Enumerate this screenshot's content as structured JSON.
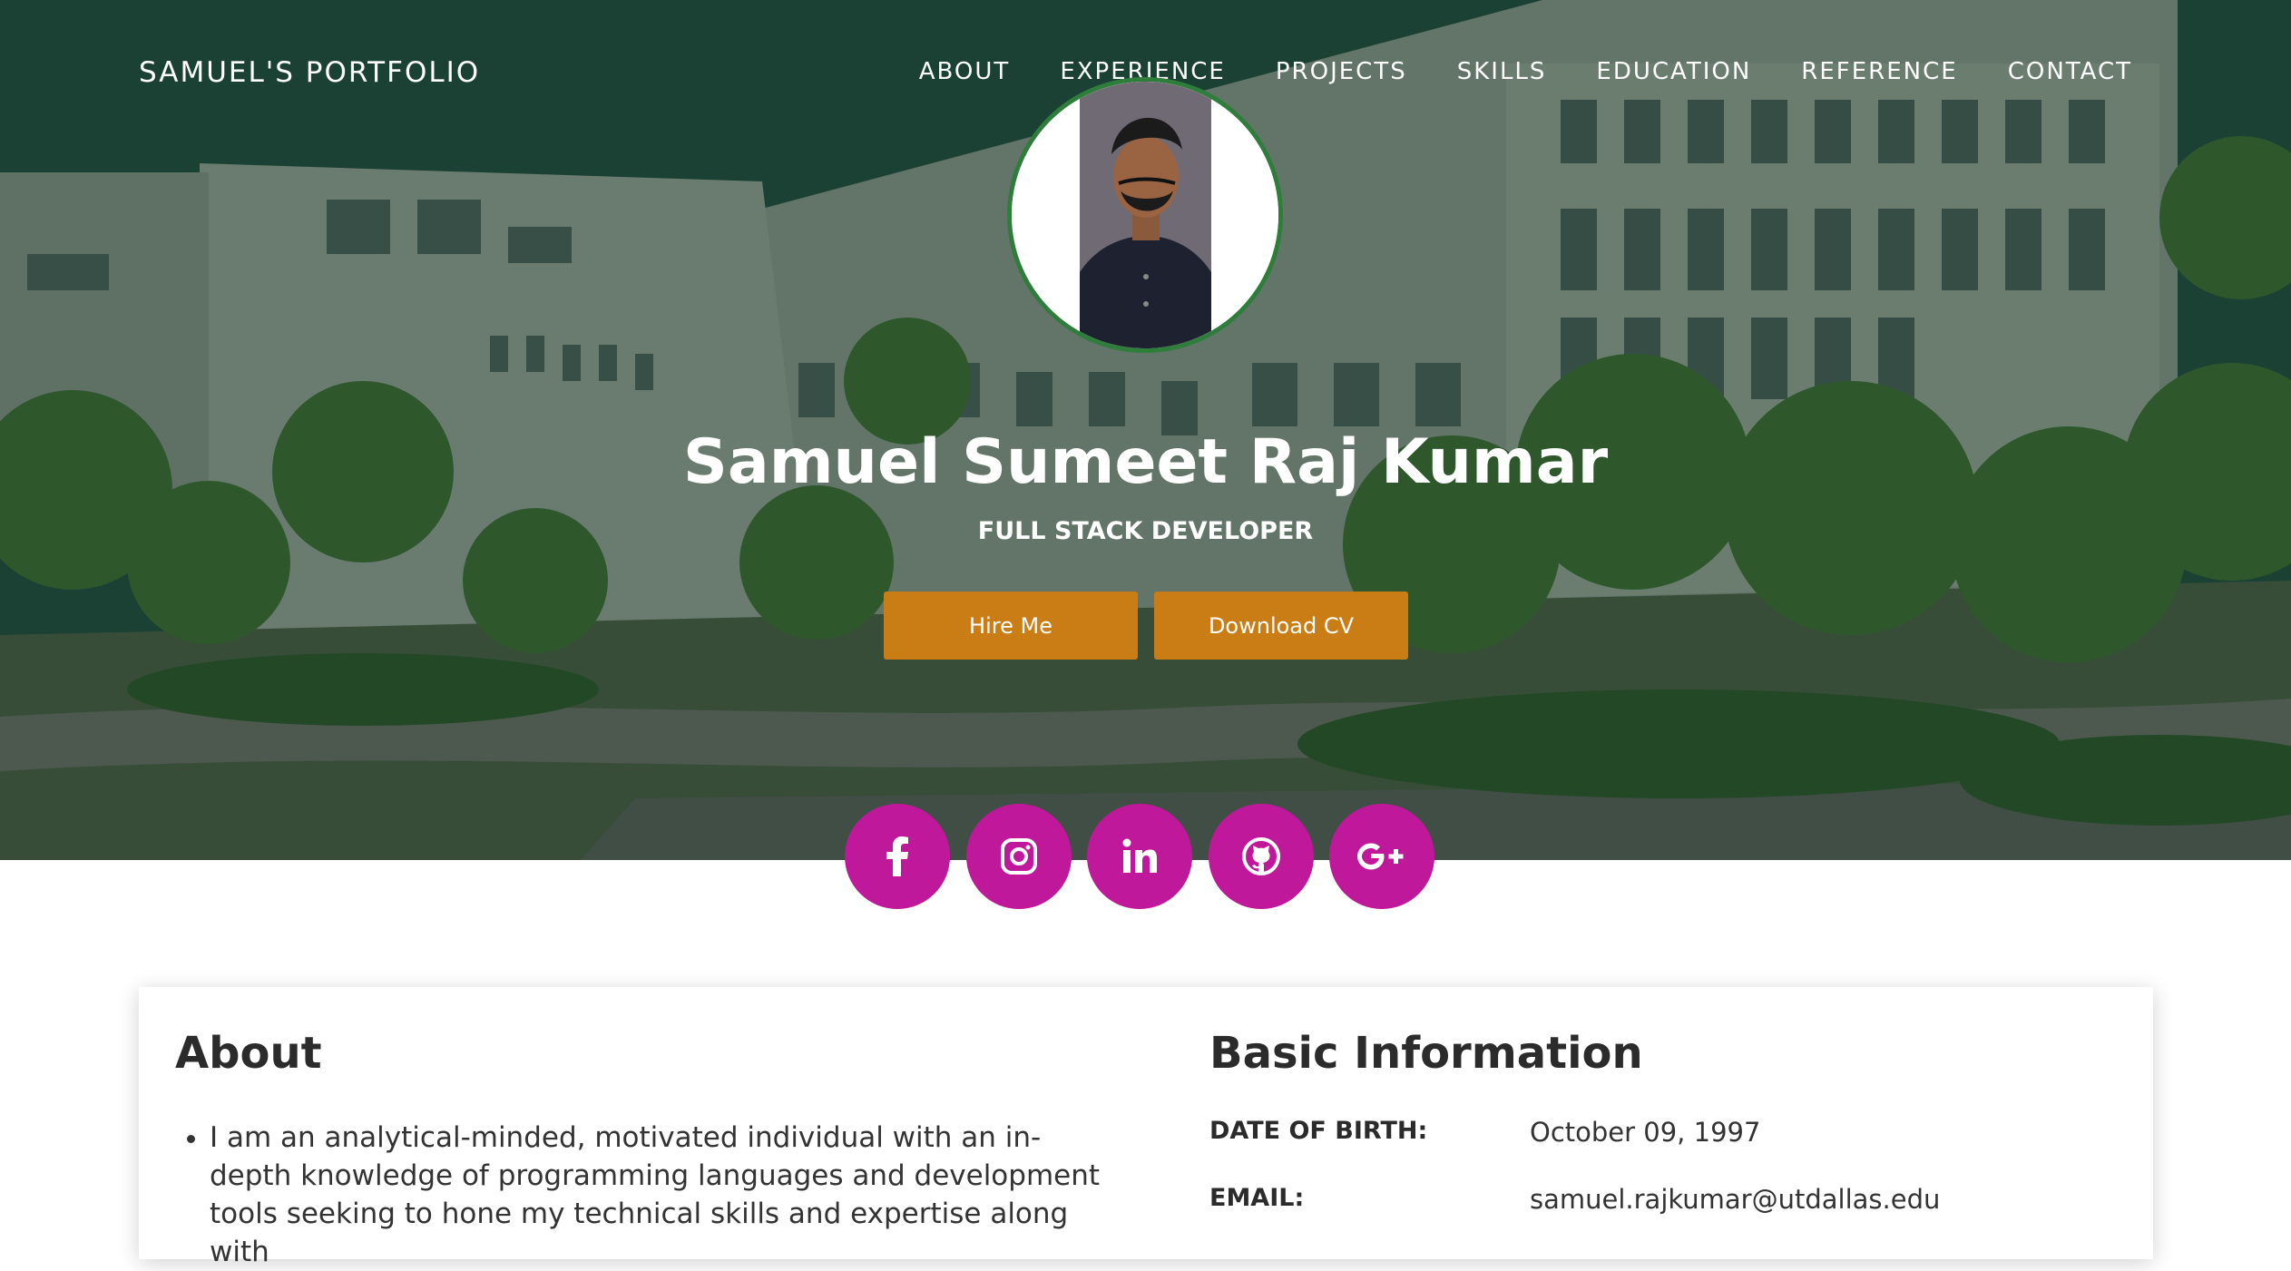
{
  "nav": {
    "brand": "SAMUEL'S PORTFOLIO",
    "links": [
      "ABOUT",
      "EXPERIENCE",
      "PROJECTS",
      "SKILLS",
      "EDUCATION",
      "REFERENCE",
      "CONTACT"
    ]
  },
  "hero": {
    "name": "Samuel Sumeet Raj Kumar",
    "role": "FULL STACK DEVELOPER",
    "hire_label": "Hire Me",
    "cv_label": "Download CV"
  },
  "social": [
    "facebook-icon",
    "instagram-icon",
    "linkedin-icon",
    "github-icon",
    "google-plus-icon"
  ],
  "about": {
    "heading": "About",
    "bullet": "I am an analytical-minded, motivated individual with an in-depth knowledge of programming languages and development tools seeking to hone my technical skills and expertise along with"
  },
  "basic_info": {
    "heading": "Basic Information",
    "rows": [
      {
        "label": "DATE OF BIRTH:",
        "value": "October 09, 1997"
      },
      {
        "label": "EMAIL:",
        "value": "samuel.rajkumar@utdallas.edu"
      }
    ]
  },
  "colors": {
    "accent_button": "#c97d14",
    "social_circle": "#c0189a",
    "avatar_ring": "#2e7d3a"
  }
}
